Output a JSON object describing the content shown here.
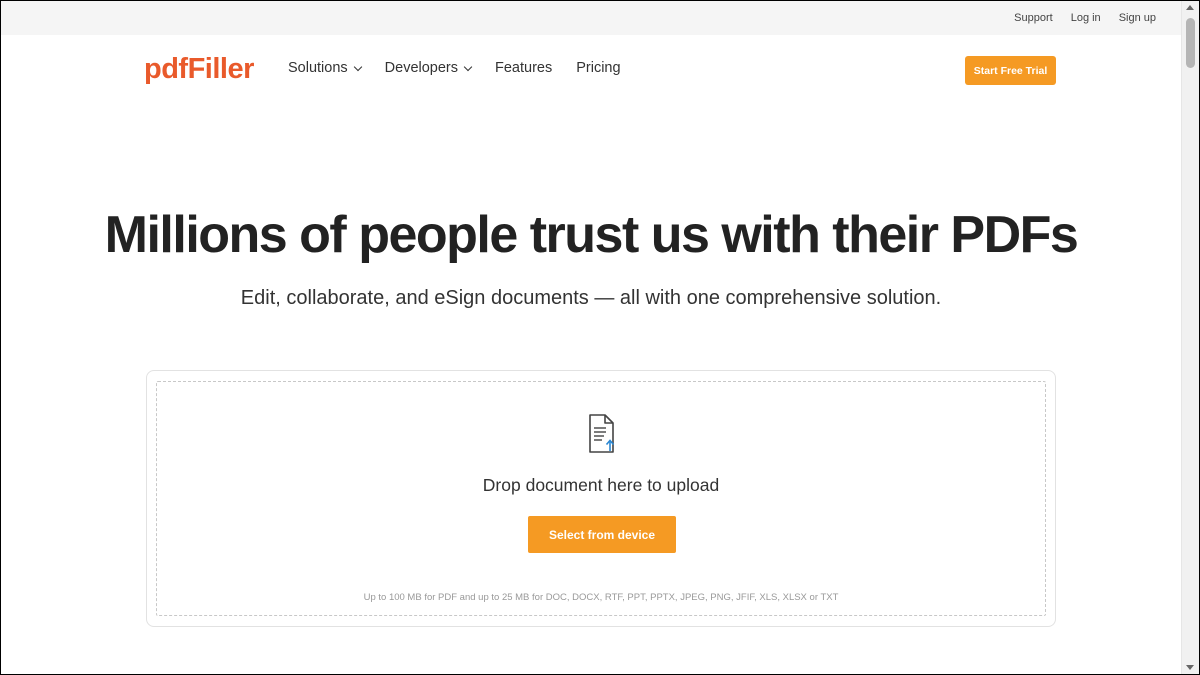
{
  "utility": {
    "support": "Support",
    "login": "Log in",
    "signup": "Sign up"
  },
  "header": {
    "logo": "pdfFiller",
    "nav": {
      "solutions": "Solutions",
      "developers": "Developers",
      "features": "Features",
      "pricing": "Pricing"
    },
    "trial_label": "Start Free Trial"
  },
  "hero": {
    "title": "Millions of people trust us with their PDFs",
    "subtitle": "Edit, collaborate, and eSign documents — all with one comprehensive solution."
  },
  "upload": {
    "icon": "document-upload-icon",
    "drop_text": "Drop document here to upload",
    "button_label": "Select from device",
    "limits": "Up to 100 MB for PDF and up to 25 MB for DOC, DOCX, RTF, PPT, PPTX, JPEG, PNG, JFIF, XLS, XLSX or TXT"
  },
  "colors": {
    "brand": "#e95a2b",
    "accent": "#f59a23"
  }
}
